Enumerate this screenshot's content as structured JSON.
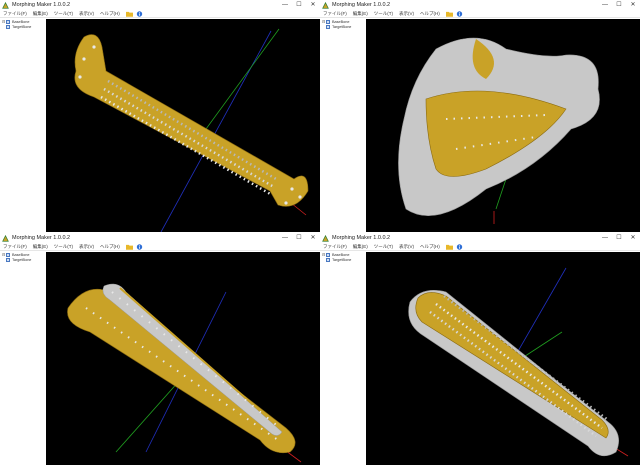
{
  "windows": [
    {
      "title": "Morphing Maker 1.0.0.2",
      "menu": [
        "ファイル(F)",
        "編集(E)",
        "ツール(T)",
        "表示(V)",
        "ヘルプ(H)"
      ],
      "tree": [
        "BaseBone",
        "TargetBone"
      ],
      "model": "femur"
    },
    {
      "title": "Morphing Maker 1.0.0.2",
      "menu": [
        "ファイル(F)",
        "編集(E)",
        "ツール(T)",
        "表示(V)",
        "ヘルプ(H)"
      ],
      "tree": [
        "BaseBone",
        "TargetBone"
      ],
      "model": "scapula"
    },
    {
      "title": "Morphing Maker 1.0.0.2",
      "menu": [
        "ファイル(F)",
        "編集(E)",
        "ツール(T)",
        "表示(V)",
        "ヘルプ(H)"
      ],
      "tree": [
        "BaseBone",
        "TargetBone"
      ],
      "model": "tibia-fibula"
    },
    {
      "title": "Morphing Maker 1.0.0.2",
      "menu": [
        "ファイル(F)",
        "編集(E)",
        "ツール(T)",
        "表示(V)",
        "ヘルプ(H)"
      ],
      "tree": [
        "BaseBone",
        "TargetBone"
      ],
      "model": "humerus"
    }
  ],
  "window_controls": [
    "—",
    "☐",
    "✕"
  ],
  "icons": {
    "app": "morphing-maker-app-icon",
    "folder": "folder-icon",
    "info": "info-icon"
  },
  "colors": {
    "gold": "#c9a227",
    "gold_dark": "#8a6a10",
    "silver": "#c8c8c8",
    "landmark": "#e8e8e8",
    "viewport": "#000000",
    "axis_x": "#d02020",
    "axis_y": "#20a020",
    "axis_z": "#2030c0"
  }
}
